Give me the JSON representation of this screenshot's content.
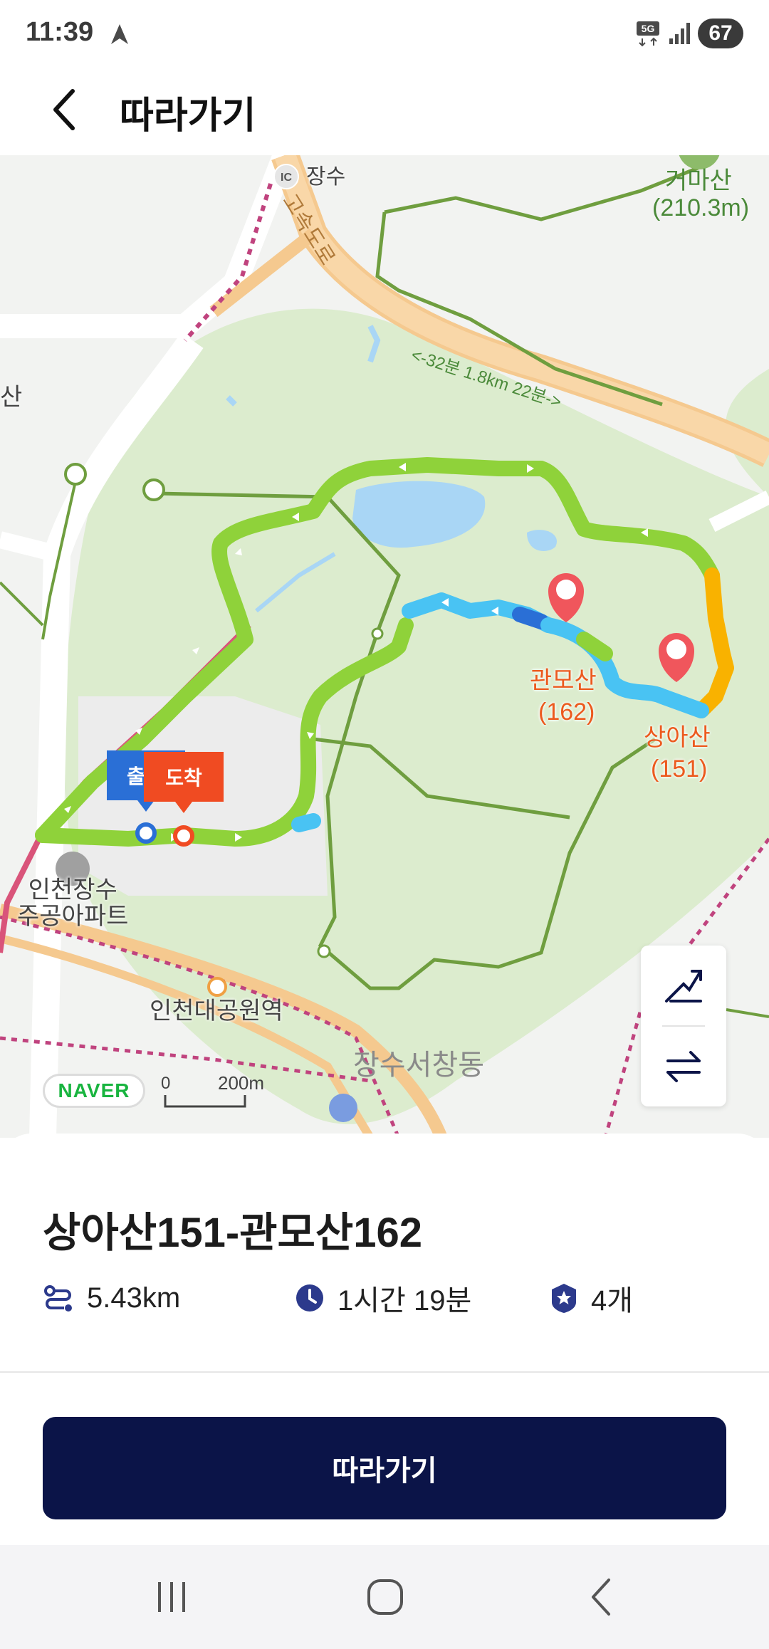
{
  "status_bar": {
    "time": "11:39",
    "network": "5G",
    "battery": "67"
  },
  "header": {
    "title": "따라가기"
  },
  "map": {
    "labels": {
      "peak_north": "거마산",
      "peak_north_height": "(210.3m)",
      "ic_badge": "IC",
      "ic_name": "장수",
      "highway_name": "고속도로",
      "edge_left": "산",
      "summit_1_name": "관모산",
      "summit_1_height": "(162)",
      "summit_2_name": "상아산",
      "summit_2_height": "(151)",
      "apartment": "인천장수\n주공아파트",
      "station": "인천대공원역",
      "district": "장수서창동",
      "trail_note": "<-32분 1.8km 22분->"
    },
    "markers": {
      "start": "출발",
      "end": "도착"
    },
    "scale": {
      "zero": "0",
      "distance": "200m"
    },
    "provider": "NAVER",
    "colors": {
      "route_green": "#8fd23a",
      "route_orange": "#f9b200",
      "route_blue": "#49c3f3",
      "park_green": "#dcecce",
      "trail": "#5c8f3a"
    }
  },
  "course": {
    "title": "상아산151-관모산162",
    "distance": "5.43km",
    "duration": "1시간 19분",
    "summit_count": "4개"
  },
  "actions": {
    "follow_label": "따라가기"
  },
  "icons": {
    "back": "back-arrow-icon",
    "elevation": "elevation-icon",
    "swap": "swap-direction-icon",
    "distance": "route-distance-icon",
    "time": "clock-icon",
    "summit": "summit-badge-icon"
  }
}
